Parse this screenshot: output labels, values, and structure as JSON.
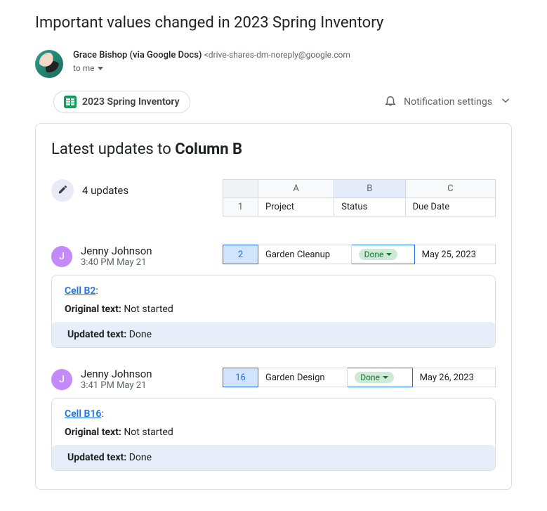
{
  "subject": "Important values changed in 2023 Spring Inventory",
  "sender": {
    "display": "Grace Bishop (via Google Docs)",
    "email": "<drive-shares-dm-noreply@google.com",
    "to": "to me"
  },
  "chip": {
    "label": "2023 Spring Inventory"
  },
  "notif": {
    "label": "Notification settings"
  },
  "card": {
    "title_prefix": "Latest updates to ",
    "title_bold": "Column B",
    "updates_text": "4 updates"
  },
  "header_grid": {
    "cols": [
      "A",
      "B",
      "C"
    ],
    "row1_num": "1",
    "row1": [
      "Project",
      "Status",
      "Due Date"
    ]
  },
  "labels": {
    "cell_prefix": "Cell ",
    "original": "Original text:",
    "updated": "Updated text:"
  },
  "changes": [
    {
      "user": {
        "initial": "J",
        "name": "Jenny Johnson",
        "time": "3:40 PM May 21"
      },
      "grid": {
        "rownum": "2",
        "project": "Garden Cleanup",
        "status": "Done",
        "due": "May 25, 2023"
      },
      "cell_ref": "B2",
      "original": "Not started",
      "updated": "Done"
    },
    {
      "user": {
        "initial": "J",
        "name": "Jenny Johnson",
        "time": "3:41 PM May 21"
      },
      "grid": {
        "rownum": "16",
        "project": "Garden Design",
        "status": "Done",
        "due": "May 26, 2023"
      },
      "cell_ref": "B16",
      "original": "Not started",
      "updated": "Done"
    }
  ]
}
